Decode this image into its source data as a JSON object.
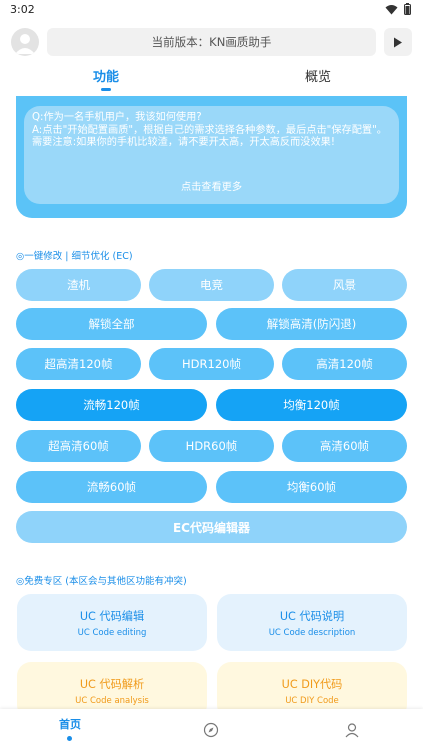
{
  "status_bar": {
    "time": "3:02"
  },
  "header": {
    "version_text": "当前版本：KN画质助手"
  },
  "tabs": [
    {
      "label": "功能"
    },
    {
      "label": "概览"
    }
  ],
  "faq": {
    "lines": [
      "Q:作为一名手机用户，我该如何使用?",
      "A:点击\"开始配置画质\"，根据自己的需求选择各种参数，最后点击\"保存配置\"。",
      "需要注意:如果你的手机比较渣，请不要开太高，开太高反而没效果!"
    ],
    "more_link": "点击查看更多"
  },
  "ec_section": {
    "title": "◎一键修改 | 细节优化 (EC)",
    "row1": [
      "渣机",
      "电竞",
      "风景"
    ],
    "row2": [
      "解锁全部",
      "解锁高清(防闪退)"
    ],
    "row3": [
      "超高清120帧",
      "HDR120帧",
      "高清120帧"
    ],
    "row4": [
      "流畅120帧",
      "均衡120帧"
    ],
    "row5": [
      "超高清60帧",
      "HDR60帧",
      "高清60帧"
    ],
    "row6": [
      "流畅60帧",
      "均衡60帧"
    ],
    "editor": "EC代码编辑器"
  },
  "free_section": {
    "title": "◎免费专区 (本区会与其他区功能有冲突)",
    "cards": [
      {
        "title": "UC 代码编辑",
        "subtitle": "UC Code editing"
      },
      {
        "title": "UC 代码说明",
        "subtitle": "UC Code description"
      },
      {
        "title": "UC 代码解析",
        "subtitle": "UC Code analysis"
      },
      {
        "title": "UC DIY代码",
        "subtitle": "UC DIY Code"
      }
    ]
  },
  "bottom_nav": {
    "home": "首页"
  },
  "colors": {
    "accent": "#1a8ee8",
    "panel": "#5bc3f7",
    "button_light": "#8fd3fa",
    "button_dark": "#15a3f5",
    "card_blue": "#e4f2fd",
    "card_yellow": "#fff8df"
  },
  "icons": [
    "wifi-icon",
    "battery-icon",
    "avatar-icon",
    "play-icon",
    "compass-icon",
    "user-icon"
  ]
}
